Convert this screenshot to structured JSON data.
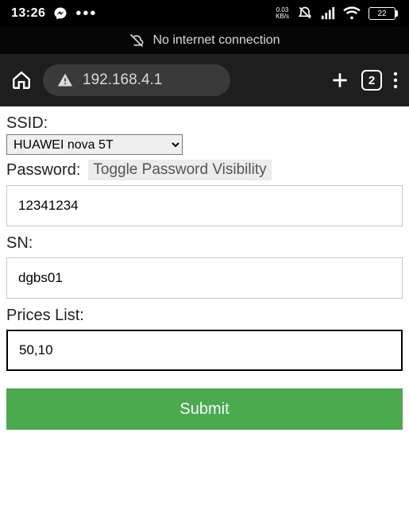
{
  "statusbar": {
    "time": "13:26",
    "kbps_value": "0.03",
    "kbps_unit": "KB/s",
    "battery_pct": "22",
    "tab_count": "2"
  },
  "banner": {
    "text": "No internet connection"
  },
  "urlbar": {
    "address": "192.168.4.1"
  },
  "form": {
    "ssid_label": "SSID:",
    "ssid_value": "HUAWEI nova 5T",
    "password_label": "Password:",
    "toggle_label": "Toggle Password Visibility",
    "password_value": "12341234",
    "sn_label": "SN:",
    "sn_value": "dgbs01",
    "prices_label": "Prices List:",
    "prices_value": "50,10",
    "submit_label": "Submit"
  }
}
